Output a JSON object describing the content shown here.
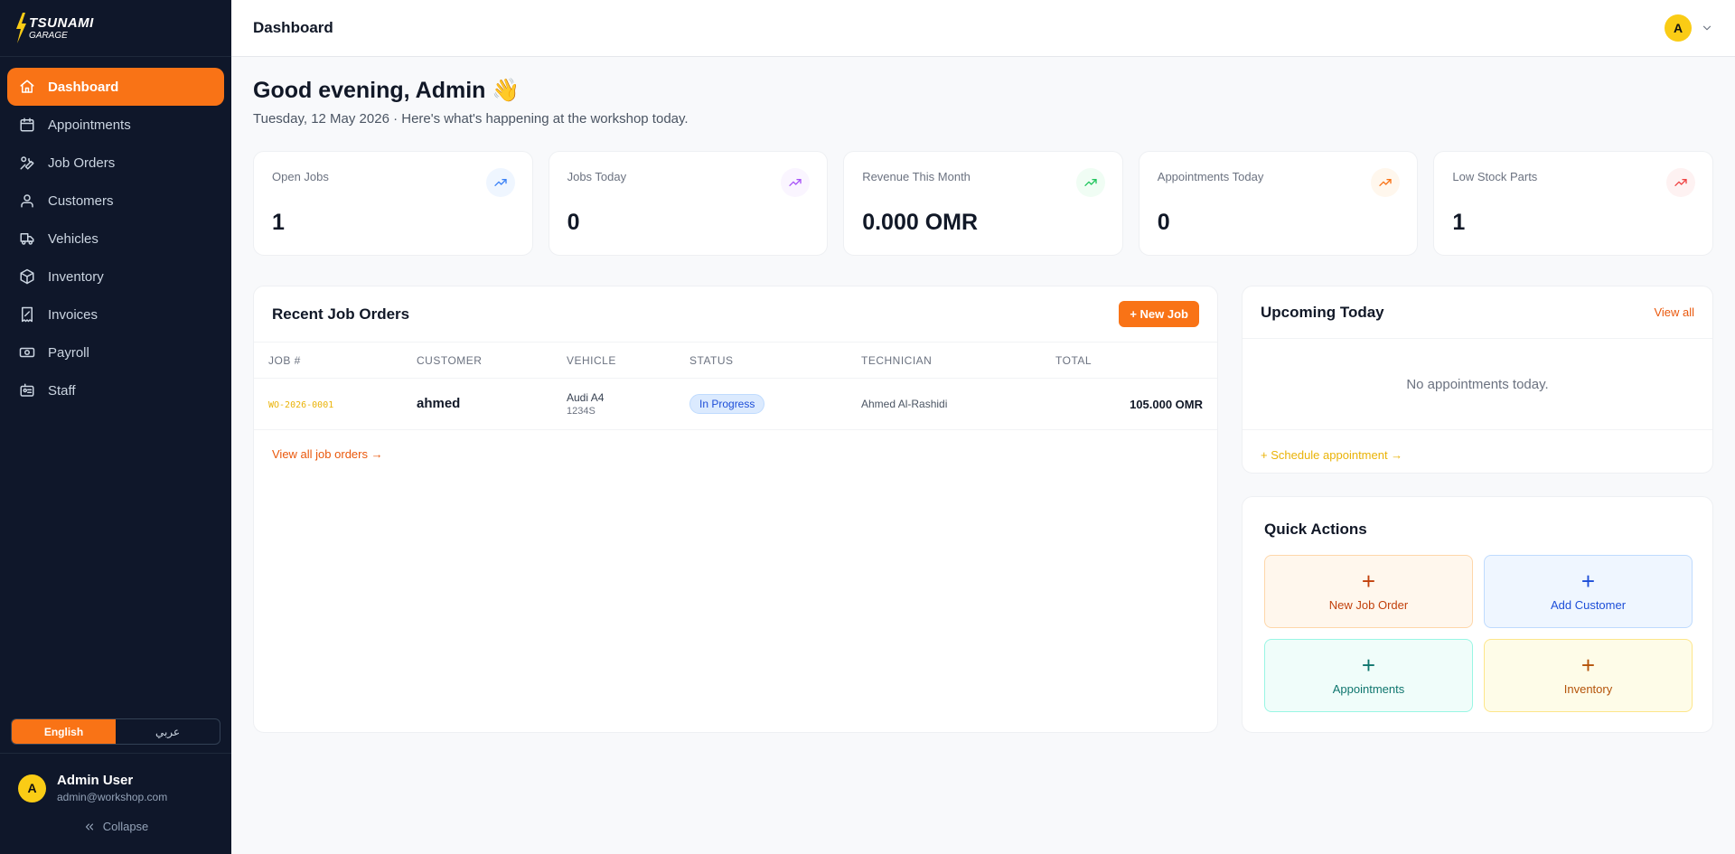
{
  "brand": {
    "line1": "TSUNAMI",
    "line2": "GARAGE"
  },
  "nav": [
    {
      "label": "Dashboard",
      "icon": "home-icon",
      "active": true
    },
    {
      "label": "Appointments",
      "icon": "calendar-icon"
    },
    {
      "label": "Job Orders",
      "icon": "wrench-icon"
    },
    {
      "label": "Customers",
      "icon": "users-icon"
    },
    {
      "label": "Vehicles",
      "icon": "truck-icon"
    },
    {
      "label": "Inventory",
      "icon": "package-icon"
    },
    {
      "label": "Invoices",
      "icon": "receipt-icon"
    },
    {
      "label": "Payroll",
      "icon": "cash-icon"
    },
    {
      "label": "Staff",
      "icon": "id-card-icon"
    }
  ],
  "language": {
    "english": "English",
    "arabic": "عربي"
  },
  "user": {
    "initial": "A",
    "name": "Admin User",
    "email": "admin@workshop.com"
  },
  "collapse_label": "Collapse",
  "topbar": {
    "title": "Dashboard",
    "avatar_initial": "A"
  },
  "greeting": {
    "title": "Good evening, Admin 👋",
    "subtitle": "Tuesday, 12 May 2026 · Here's what's happening at the workshop today."
  },
  "stats": [
    {
      "label": "Open Jobs",
      "value": "1",
      "color": "#3b82f6",
      "bg": "#eff6ff"
    },
    {
      "label": "Jobs Today",
      "value": "0",
      "color": "#a855f7",
      "bg": "#faf5ff"
    },
    {
      "label": "Revenue This Month",
      "value": "0.000 OMR",
      "color": "#22c55e",
      "bg": "#f0fdf4"
    },
    {
      "label": "Appointments Today",
      "value": "0",
      "color": "#f97316",
      "bg": "#fff7ed"
    },
    {
      "label": "Low Stock Parts",
      "value": "1",
      "color": "#ef4444",
      "bg": "#fef2f2"
    }
  ],
  "jobs": {
    "title": "Recent Job Orders",
    "new_button": "+ New Job",
    "columns": [
      "JOB #",
      "CUSTOMER",
      "VEHICLE",
      "STATUS",
      "TECHNICIAN",
      "TOTAL"
    ],
    "rows": [
      {
        "job": "WO-2026-0001",
        "customer": "ahmed",
        "vehicle": "Audi A4",
        "plate": "1234S",
        "status": "In Progress",
        "technician": "Ahmed Al-Rashidi",
        "total": "105.000 OMR"
      }
    ],
    "view_all": "View all job orders →"
  },
  "upcoming": {
    "title": "Upcoming Today",
    "view_all": "View all",
    "empty": "No appointments today.",
    "schedule": "+ Schedule appointment →"
  },
  "quick_actions": {
    "title": "Quick Actions",
    "items": [
      {
        "label": "New Job Order",
        "color": "#c2410c",
        "bg": "#fff7ed",
        "border": "#fed7aa"
      },
      {
        "label": "Add Customer",
        "color": "#1d4ed8",
        "bg": "#eff6ff",
        "border": "#bfdbfe"
      },
      {
        "label": "Appointments",
        "color": "#0f766e",
        "bg": "#f0fdfa",
        "border": "#99f6e4"
      },
      {
        "label": "Inventory",
        "color": "#b45309",
        "bg": "#fefce8",
        "border": "#fde68a"
      }
    ]
  }
}
